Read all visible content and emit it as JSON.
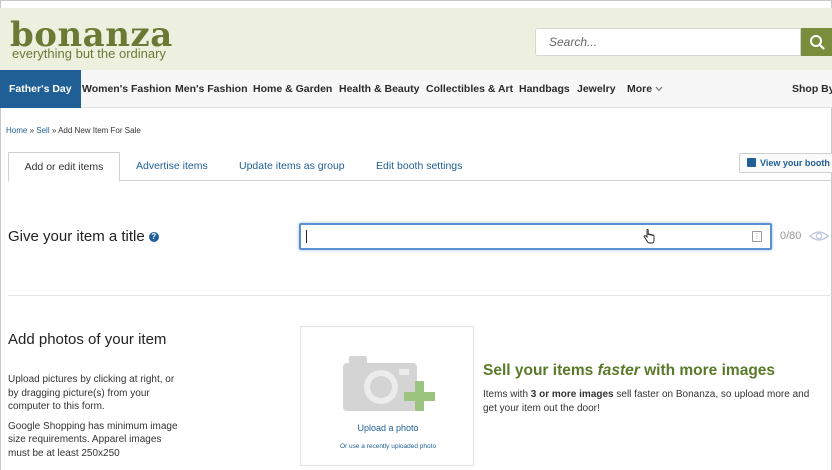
{
  "header": {
    "logo_name": "bonanza",
    "logo_tagline": "everything but the ordinary",
    "search_placeholder": "Search..."
  },
  "nav": {
    "items": [
      {
        "label": "Father's Day"
      },
      {
        "label": "Women's Fashion"
      },
      {
        "label": "Men's Fashion"
      },
      {
        "label": "Home & Garden"
      },
      {
        "label": "Health & Beauty"
      },
      {
        "label": "Collectibles & Art"
      },
      {
        "label": "Handbags"
      },
      {
        "label": "Jewelry"
      },
      {
        "label": "More"
      },
      {
        "label": "Shop By"
      }
    ]
  },
  "breadcrumb": {
    "home": "Home",
    "sell": "Sell",
    "current": "Add New Item For Sale",
    "sep": "»"
  },
  "tabs": [
    {
      "label": "Add or edit items"
    },
    {
      "label": "Advertise items"
    },
    {
      "label": "Update items as group"
    },
    {
      "label": "Edit booth settings"
    }
  ],
  "view_booth_label": "View your booth",
  "title_section": {
    "label": "Give your item a title",
    "help": "?",
    "value": "",
    "char_count": "0/80"
  },
  "photos": {
    "heading": "Add photos of your item",
    "desc1": "Upload pictures by clicking at right, or by dragging picture(s) from your computer to this form.",
    "desc2": "Google Shopping has minimum image size requirements. Apparel images must be at least 250x250",
    "upload_label": "Upload a photo",
    "recent_label": "Or use a recently uploaded photo"
  },
  "promo": {
    "heading_pre": "Sell your items ",
    "heading_em": "faster",
    "heading_post": " with more images",
    "text_pre": "Items with ",
    "text_bold": "3 or more images",
    "text_post": " sell faster on Bonanza, so upload more and get your item out the door!"
  },
  "colors": {
    "brand_green": "#6a7a34",
    "nav_active_blue": "#1f5f95",
    "header_bg": "#eef0df",
    "promo_green": "#5a7a2a"
  }
}
